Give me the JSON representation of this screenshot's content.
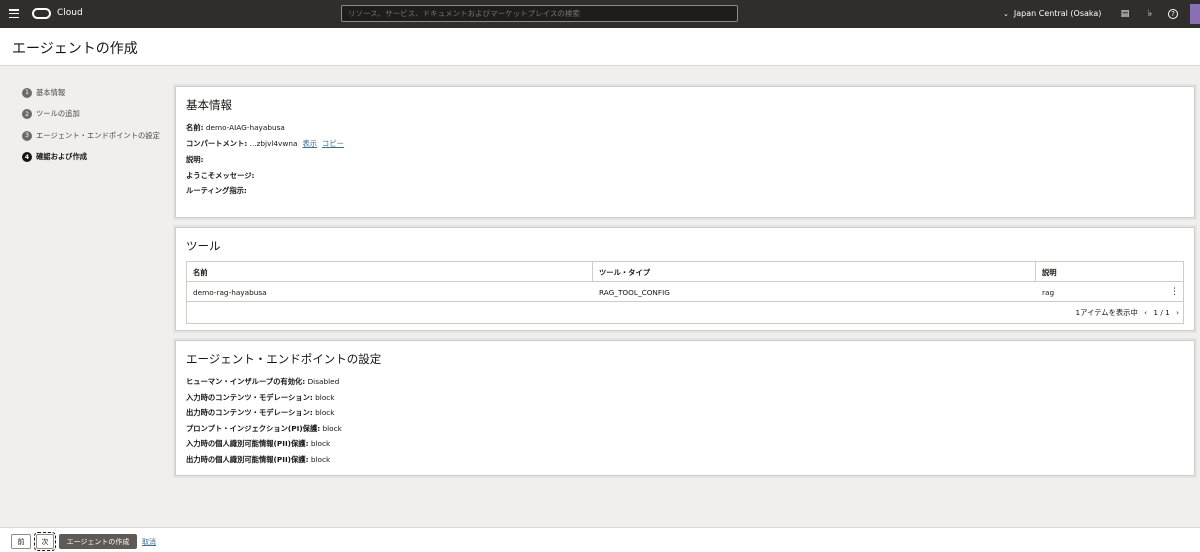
{
  "topbar": {
    "brand": "Cloud",
    "search_placeholder": "リソース、サービス、ドキュメントおよびマーケットプレイスの検索",
    "region": "Japan Central (Osaka)"
  },
  "page_title": "エージェントの作成",
  "steps": [
    {
      "num": "1",
      "label": "基本情報"
    },
    {
      "num": "2",
      "label": "ツールの追加"
    },
    {
      "num": "3",
      "label": "エージェント・エンドポイントの設定"
    },
    {
      "num": "4",
      "label": "確認および作成"
    }
  ],
  "basic": {
    "title": "基本情報",
    "name_label": "名前:",
    "name_value": "demo-AIAG-hayabusa",
    "compartment_label": "コンパートメント:",
    "compartment_value": "...zbjvl4vwna",
    "show_link": "表示",
    "copy_link": "コピー",
    "description_label": "説明:",
    "welcome_label": "ようこそメッセージ:",
    "routing_label": "ルーティング指示:"
  },
  "tools": {
    "title": "ツール",
    "columns": [
      "名前",
      "ツール・タイプ",
      "説明"
    ],
    "rows": [
      {
        "name": "demo-rag-hayabusa",
        "type": "RAG_TOOL_CONFIG",
        "description": "rag"
      }
    ],
    "pager_text": "1アイテムを表示中",
    "page": "1 / 1"
  },
  "endpoint": {
    "title": "エージェント・エンドポイントの設定",
    "items": [
      {
        "label": "ヒューマン・インザループの有効化:",
        "value": "Disabled"
      },
      {
        "label": "入力時のコンテンツ・モデレーション:",
        "value": "block"
      },
      {
        "label": "出力時のコンテンツ・モデレーション:",
        "value": "block"
      },
      {
        "label": "プロンプト・インジェクション(PI)保護:",
        "value": "block"
      },
      {
        "label": "入力時の個人識別可能情報(PII)保護:",
        "value": "block"
      },
      {
        "label": "出力時の個人識別可能情報(PII)保護:",
        "value": "block"
      }
    ]
  },
  "footer": {
    "prev": "前",
    "next": "次",
    "create": "エージェントの作成",
    "cancel": "取消"
  }
}
